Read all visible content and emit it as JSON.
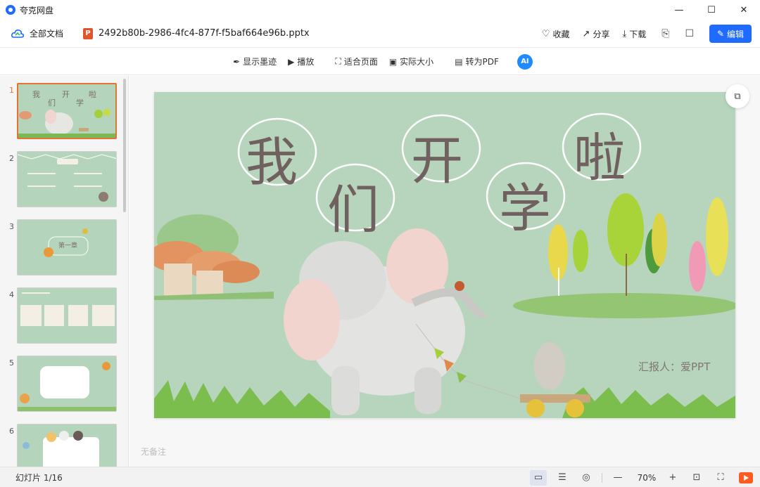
{
  "window": {
    "app_name": "夸克网盘",
    "controls": {
      "minimize": "—",
      "maximize": "☐",
      "close": "✕"
    }
  },
  "header": {
    "all_docs_label": "全部文档",
    "file_type_badge": "P",
    "file_name": "2492b80b-2986-4fc4-877f-f5baf664e96b.pptx",
    "actions": [
      {
        "label": "收藏",
        "icon": "heart-icon"
      },
      {
        "label": "分享",
        "icon": "share-icon"
      },
      {
        "label": "下载",
        "icon": "download-icon"
      }
    ],
    "edit_label": "编辑",
    "accent_color": "#1f6bff"
  },
  "toolbar": {
    "show_ink": "显示墨迹",
    "play": "播放",
    "fit_page": "适合页面",
    "actual_size": "实际大小",
    "to_pdf": "转为PDF",
    "ai_badge": "AI"
  },
  "thumbnails": {
    "numbers": [
      "1",
      "2",
      "3",
      "4",
      "5",
      "6"
    ],
    "selected_index": 0,
    "slide1_chars": [
      "我",
      "开",
      "啦",
      "们",
      "学"
    ],
    "slide3_heading": "第一章"
  },
  "slide": {
    "title_chars": [
      "我",
      "开",
      "啦",
      "们",
      "学"
    ],
    "reporter": "汇报人：爱PPT"
  },
  "notes_placeholder": "无备注",
  "status": {
    "slide_count": "幻灯片 1/16",
    "zoom": "70%"
  }
}
